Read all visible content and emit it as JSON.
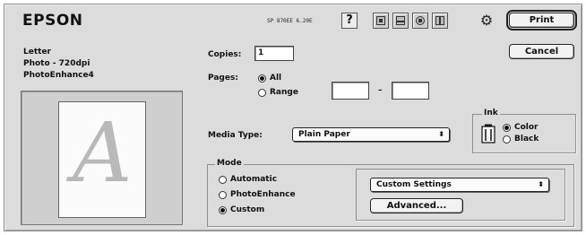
{
  "header": {
    "brand": "EPSON",
    "model": "SP 870EE 6.20E",
    "help_label": "?"
  },
  "buttons": {
    "print": "Print",
    "cancel": "Cancel",
    "advanced": "Advanced..."
  },
  "summary": {
    "paper": "Letter",
    "quality": "Photo - 720dpi",
    "enhance": "PhotoEnhance4",
    "preview_letter": "A"
  },
  "copies": {
    "label": "Copies:",
    "value": "1"
  },
  "pages": {
    "label": "Pages:",
    "all_label": "All",
    "range_label": "Range",
    "range_separator": "–",
    "from_value": "",
    "to_value": "",
    "selected": "All"
  },
  "media_type": {
    "label": "Media Type:",
    "value": "Plain Paper",
    "arrow": "⬍"
  },
  "ink": {
    "title": "Ink",
    "color_label": "Color",
    "black_label": "Black",
    "selected": "Color"
  },
  "mode": {
    "title": "Mode",
    "automatic_label": "Automatic",
    "photoenhance_label": "PhotoEnhance",
    "custom_label": "Custom",
    "selected": "Custom",
    "custom_settings_value": "Custom Settings",
    "arrow": "⬍"
  },
  "icons": {
    "toolbar": [
      "print-preview-icon",
      "layout-icon",
      "utility-icon",
      "status-monitor-icon"
    ],
    "gear": "gear-icon",
    "ink_cartridge": "ink-cartridge-icon"
  },
  "colors": {
    "dialog_bg": "#dcdcdc",
    "preview_bg": "#cfcfcf"
  }
}
